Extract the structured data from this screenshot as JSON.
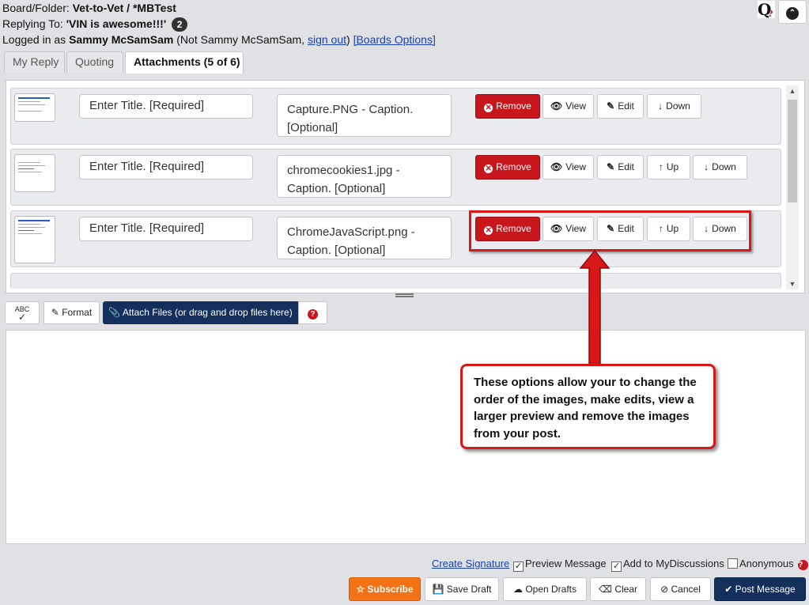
{
  "header": {
    "board_label": "Board/Folder:",
    "board_value": "Vet-to-Vet / *MBTest",
    "reply_label": "Replying To:",
    "reply_value": "'VIN is awesome!!!'",
    "reply_count": "2",
    "logged_label": "Logged in as",
    "user_name": "Sammy McSamSam",
    "not_user_prefix": "(Not Sammy McSamSam,",
    "sign_out": "sign out",
    "not_user_suffix": ")",
    "boards_options": "[Boards Options]",
    "q_icon_letter": "Q",
    "q_icon_mark": "?"
  },
  "tabs": [
    "My Reply",
    "Quoting",
    "Attachments (5 of 6)"
  ],
  "attachments": [
    {
      "title_placeholder": "Enter Title. [Required]",
      "caption_line1": "Capture.PNG - Caption.",
      "caption_line2": "[Optional]"
    },
    {
      "title_placeholder": "Enter Title. [Required]",
      "caption_line1": "chromecookies1.jpg -",
      "caption_line2": "Caption. [Optional]"
    },
    {
      "title_placeholder": "Enter Title. [Required]",
      "caption_line1": "ChromeJavaScript.png -",
      "caption_line2": "Caption. [Optional]"
    }
  ],
  "attachment_buttons": {
    "remove": "Remove",
    "view": "View",
    "edit": "Edit",
    "up": "Up",
    "down": "Down"
  },
  "toolbar": {
    "spell_top": "ABC",
    "format": "Format",
    "attach": "Attach Files (or drag and drop files here)"
  },
  "callout": "These options allow your to change the order of the images, make edits, view a larger preview and remove the images from your post.",
  "options": {
    "create_signature": "Create Signature",
    "preview_message": "Preview Message",
    "add_to_mydiscussions": "Add to MyDiscussions",
    "anonymous": "Anonymous"
  },
  "bottom_buttons": {
    "subscribe": "Subscribe",
    "save_draft": "Save Draft",
    "open_drafts": "Open Drafts",
    "clear": "Clear",
    "cancel": "Cancel",
    "post_message": "Post Message"
  },
  "colors": {
    "accent_red": "#c8161d",
    "navy": "#132f5c",
    "orange": "#f47216",
    "callout_red": "#d81818"
  }
}
